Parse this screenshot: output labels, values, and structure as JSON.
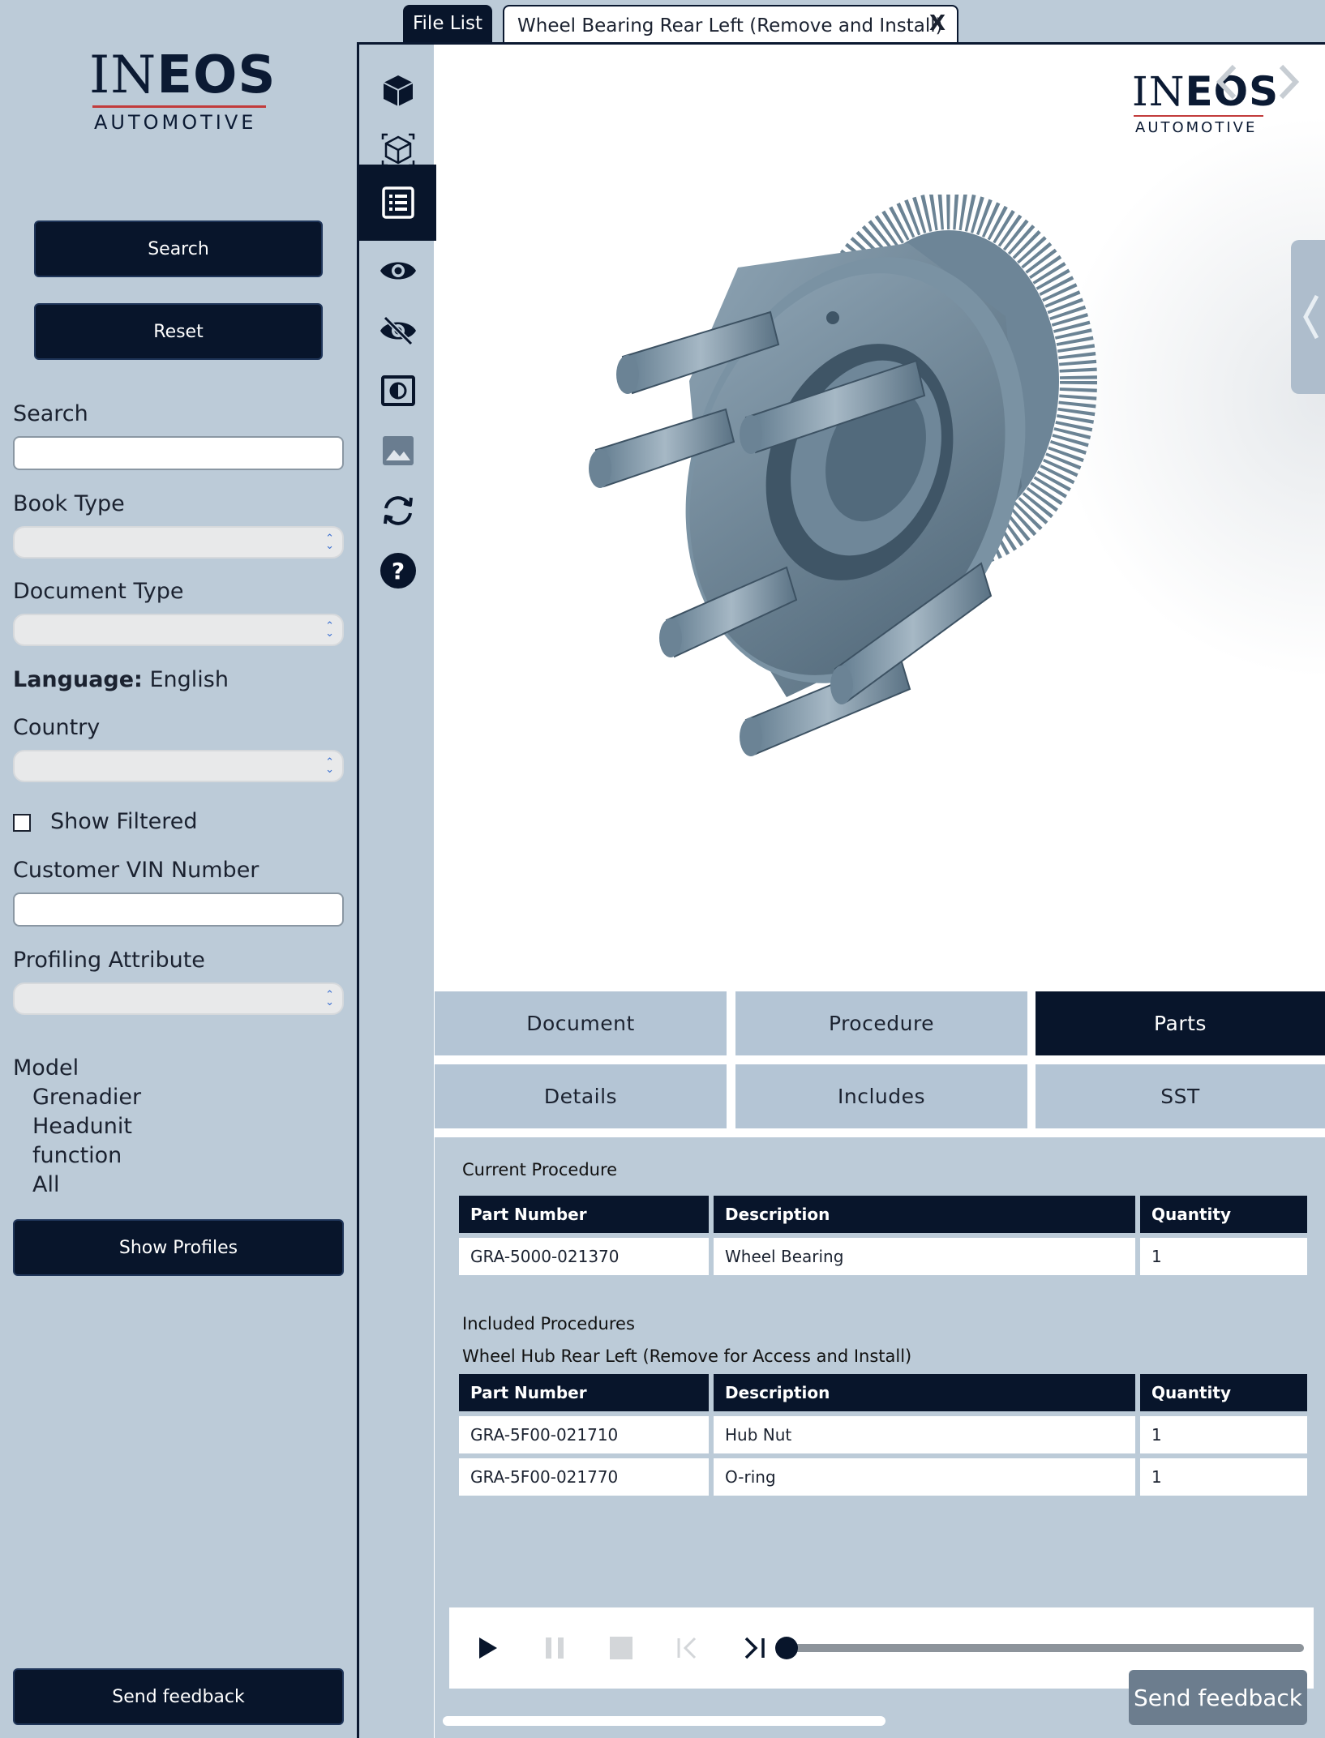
{
  "logo": {
    "brand_left": "IN",
    "brand_right": "EOS",
    "sub": "AUTOMOTIVE"
  },
  "sidebar": {
    "search_button": "Search",
    "reset_button": "Reset",
    "search_label": "Search",
    "search_value": "",
    "book_type_label": "Book Type",
    "document_type_label": "Document Type",
    "language_label": "Language:",
    "language_value": "English",
    "country_label": "Country",
    "show_filtered_label": "Show Filtered",
    "vin_label": "Customer VIN Number",
    "vin_value": "",
    "profiling_label": "Profiling Attribute",
    "model_heading": "Model",
    "model_items": [
      "Grenadier",
      "Headunit",
      "function",
      "All"
    ],
    "show_profiles_button": "Show  Profiles",
    "send_feedback_button": "Send feedback"
  },
  "tabs": {
    "file_list": "File List",
    "document_tab": "Wheel Bearing Rear Left (Remove and Install)",
    "close": "X"
  },
  "toolbar": {
    "icons": [
      "cube-icon",
      "wireframe-cube-icon",
      "parts-list-icon",
      "show-icon",
      "hide-icon",
      "contrast-icon",
      "image-icon",
      "refresh-icon",
      "help-icon"
    ],
    "active_index": 2
  },
  "segments": {
    "row1": [
      "Document",
      "Procedure",
      "Parts"
    ],
    "row2": [
      "Details",
      "Includes",
      "SST"
    ],
    "active": "Parts"
  },
  "parts": {
    "current_title": "Current Procedure",
    "columns": [
      "Part Number",
      "Description",
      "Quantity"
    ],
    "current_rows": [
      [
        "GRA-5000-021370",
        "Wheel Bearing",
        "1"
      ]
    ],
    "included_title": "Included Procedures",
    "included_subtitle": "Wheel Hub Rear Left (Remove for Access and Install)",
    "included_rows": [
      [
        "GRA-5F00-021710",
        "Hub Nut",
        "1"
      ],
      [
        "GRA-5F00-021770",
        "O-ring",
        "1"
      ]
    ]
  },
  "player": {
    "progress": 0
  },
  "floating_feedback": "Send feedback",
  "colors": {
    "navy": "#08152b",
    "background": "#bccbd8",
    "segment": "#b4c5d5"
  }
}
